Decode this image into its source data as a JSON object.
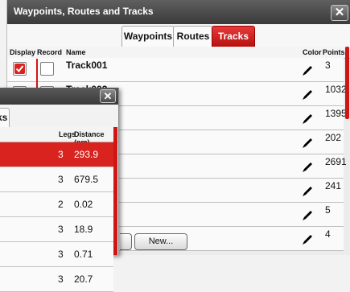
{
  "back_dialog": {
    "title": "Waypoints, Routes and Tracks",
    "close_glyph": "✕",
    "tabs": [
      "Waypoints",
      "Routes",
      "Tracks"
    ],
    "active_tab": "Tracks",
    "columns": {
      "display": "Display",
      "record": "Record",
      "name": "Name",
      "color": "Color",
      "points": "Points"
    },
    "rows": [
      {
        "name": "Track001",
        "points": "3",
        "display_checked": true,
        "record_checked": false
      },
      {
        "name": "Track002",
        "points": "1032",
        "display_checked": false,
        "record_checked": false
      },
      {
        "name": "",
        "points": "1395"
      },
      {
        "name": "",
        "points": "202"
      },
      {
        "name": "",
        "points": "2691"
      },
      {
        "name": "",
        "points": "241"
      },
      {
        "name": "",
        "points": "5"
      },
      {
        "name": "",
        "points": "4"
      }
    ],
    "new_button_label": "New..."
  },
  "front_dialog": {
    "close_glyph": "✕",
    "tab_partial_label": "ks",
    "columns": {
      "legs": "Legs",
      "distance": "Distance (nm)"
    },
    "rows": [
      {
        "legs": "3",
        "distance": "293.9",
        "selected": true
      },
      {
        "legs": "3",
        "distance": "679.5"
      },
      {
        "legs": "2",
        "distance": "0.02"
      },
      {
        "legs": "3",
        "distance": "18.9"
      },
      {
        "legs": "3",
        "distance": "0.71"
      },
      {
        "legs": "3",
        "distance": "20.7"
      }
    ]
  },
  "colors": {
    "accent_red": "#d8231f",
    "titlebar": "#4a4a4a",
    "track_color_icon": "#000000"
  },
  "icons": {
    "close": "close-icon",
    "track_color": "pencil-icon",
    "checkbox_checked": "checkmark-icon"
  }
}
